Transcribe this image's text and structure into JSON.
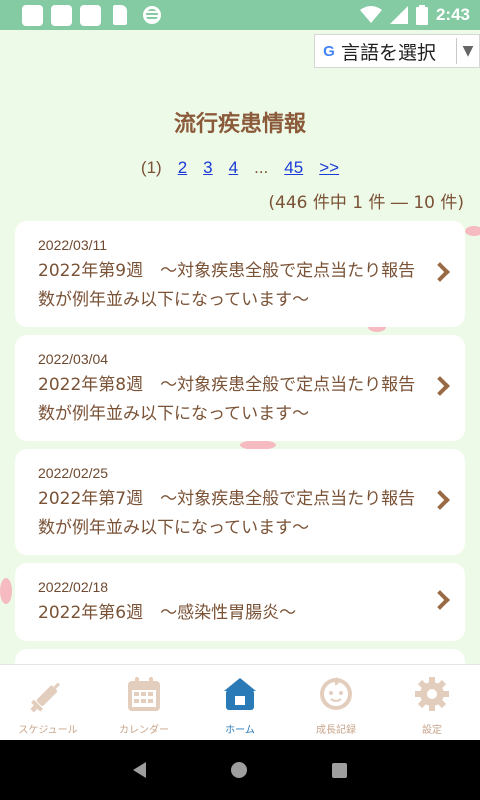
{
  "status_bar": {
    "time": "2:43",
    "icons": [
      "notification-icon",
      "notification-icon",
      "notification-icon",
      "sd-card-icon",
      "sync-icon",
      "wifi-icon",
      "signal-icon",
      "battery-icon"
    ]
  },
  "translate": {
    "label": "言語を選択",
    "arrow": "▼"
  },
  "page_title": "流行疾患情報",
  "pager": {
    "current": "(1)",
    "pages": [
      "2",
      "3",
      "4"
    ],
    "ellipsis": "...",
    "last": "45",
    "next": ">>",
    "count_text": "(446 件中 1 件 ― 10 件)"
  },
  "cards": [
    {
      "date": "2022/03/11",
      "title": "2022年第9週　〜対象疾患全般で定点当たり報告数が例年並み以下になっています〜"
    },
    {
      "date": "2022/03/04",
      "title": "2022年第8週　〜対象疾患全般で定点当たり報告数が例年並み以下になっています〜"
    },
    {
      "date": "2022/02/25",
      "title": "2022年第7週　〜対象疾患全般で定点当たり報告数が例年並み以下になっています〜"
    },
    {
      "date": "2022/02/18",
      "title": "2022年第6週　〜感染性胃腸炎〜"
    }
  ],
  "bottom_nav": {
    "items": [
      {
        "label": "スケジュール",
        "icon": "syringe-icon",
        "active": false
      },
      {
        "label": "カレンダー",
        "icon": "calendar-icon",
        "active": false
      },
      {
        "label": "ホーム",
        "icon": "home-icon",
        "active": true
      },
      {
        "label": "成長記録",
        "icon": "baby-face-icon",
        "active": false
      },
      {
        "label": "設定",
        "icon": "gear-icon",
        "active": false
      }
    ]
  },
  "colors": {
    "status_bar": "#84cba3",
    "background": "#eefae8",
    "title_brown": "#8a5a3a",
    "link_blue": "#1a3bd6",
    "active_blue": "#2a7ab8",
    "inactive_icon": "#e3cdbd"
  }
}
